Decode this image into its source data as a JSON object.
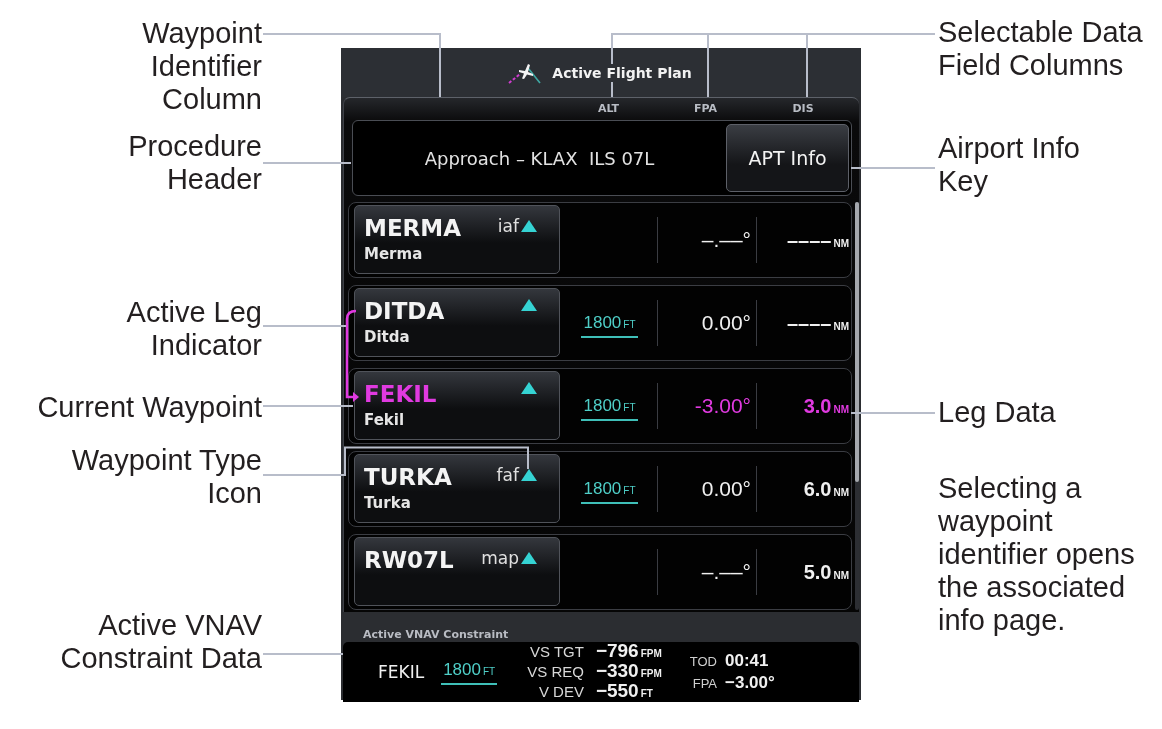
{
  "callouts_left": [
    {
      "text": "Waypoint Identifier Column"
    },
    {
      "text": "Procedure Header"
    },
    {
      "text": "Active Leg Indicator"
    },
    {
      "text": "Current Waypoint"
    },
    {
      "text": "Waypoint Type Icon"
    },
    {
      "text": "Active VNAV Constraint Data"
    }
  ],
  "callouts_right": [
    {
      "text": "Selectable Data Field Columns"
    },
    {
      "text": "Airport Info Key"
    },
    {
      "text": "Leg Data"
    }
  ],
  "note": "Selecting a waypoint identifier opens the associated info page.",
  "screen": {
    "title": "Active Flight Plan",
    "columns": [
      "ALT",
      "FPA",
      "DIS"
    ],
    "procedure": {
      "text": "Approach – KLAX  ILS 07L",
      "button": "APT Info"
    },
    "rows": [
      {
        "ident": "MERMA",
        "name": "Merma",
        "type": "iaf",
        "fpa": "–.––°",
        "dis": "––––",
        "dis_unit": "NM",
        "active": false
      },
      {
        "ident": "DITDA",
        "name": "Ditda",
        "alt": "1800",
        "alt_unit": "FT",
        "fpa": "0.00°",
        "dis": "––––",
        "dis_unit": "NM",
        "active": false
      },
      {
        "ident": "FEKIL",
        "name": "Fekil",
        "alt": "1800",
        "alt_unit": "FT",
        "fpa": "-3.00°",
        "dis": "3.0",
        "dis_unit": "NM",
        "active": true
      },
      {
        "ident": "TURKA",
        "name": "Turka",
        "type": "faf",
        "alt": "1800",
        "alt_unit": "FT",
        "fpa": "0.00°",
        "dis": "6.0",
        "dis_unit": "NM",
        "active": false
      },
      {
        "ident": "RW07L",
        "type": "map",
        "fpa": "–.––°",
        "dis": "5.0",
        "dis_unit": "NM",
        "active": false
      }
    ],
    "vnav": {
      "label": "Active VNAV Constraint",
      "waypoint": "FEKIL",
      "alt": "1800",
      "alt_unit": "FT",
      "readings": [
        {
          "label": "VS TGT",
          "value": "−796",
          "unit": "FPM"
        },
        {
          "label": "VS REQ",
          "value": "−330",
          "unit": "FPM"
        },
        {
          "label": "V DEV",
          "value": "−550",
          "unit": "FT"
        }
      ],
      "timing": [
        {
          "label": "TOD",
          "value": "00:41"
        },
        {
          "label": "FPA",
          "value": "−3.00°"
        }
      ]
    }
  }
}
